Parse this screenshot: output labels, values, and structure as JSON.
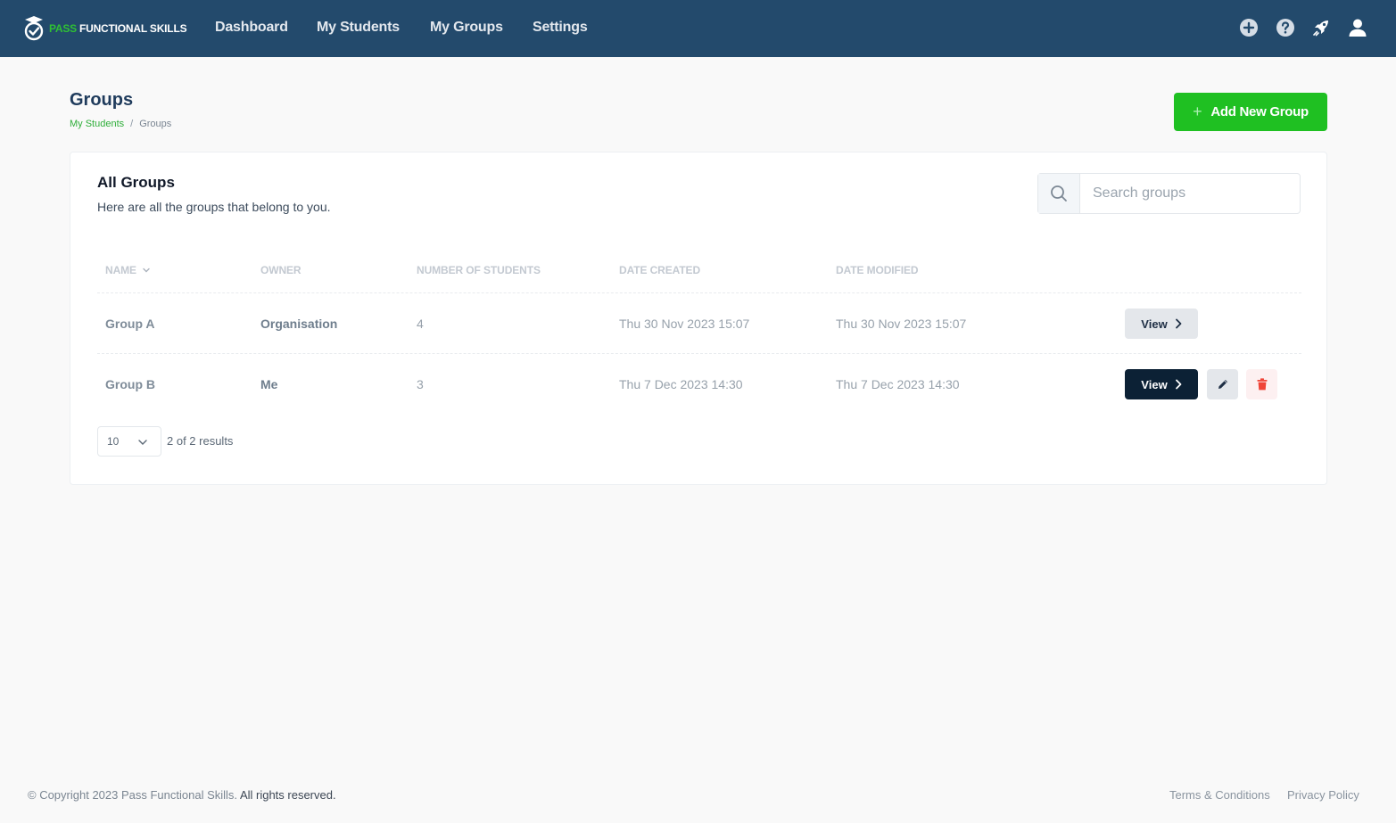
{
  "brand": {
    "part1": "PASS",
    "part2": "FUNCTIONAL SKILLS",
    "accent": "#2fc034"
  },
  "nav": {
    "items": [
      "Dashboard",
      "My Students",
      "My Groups",
      "Settings"
    ],
    "icons": [
      "plus-circle-icon",
      "help-circle-icon",
      "rocket-icon",
      "user-icon"
    ]
  },
  "header": {
    "title": "Groups",
    "breadcrumb": {
      "link": "My Students",
      "separator": "/",
      "current": "Groups"
    },
    "add_button": "Add New Group"
  },
  "card": {
    "title": "All Groups",
    "subtitle": "Here are all the groups that belong to you.",
    "search_placeholder": "Search groups",
    "columns": [
      "NAME",
      "OWNER",
      "NUMBER OF STUDENTS",
      "DATE CREATED",
      "DATE MODIFIED"
    ],
    "rows": [
      {
        "name": "Group A",
        "owner": "Organisation",
        "students": "4",
        "created": "Thu 30 Nov 2023 15:07",
        "modified": "Thu 30 Nov 2023 15:07",
        "view": "View"
      },
      {
        "name": "Group B",
        "owner": "Me",
        "students": "3",
        "created": "Thu 7 Dec 2023 14:30",
        "modified": "Thu 7 Dec 2023 14:30",
        "view": "View"
      }
    ],
    "page_size": "10",
    "results": "2 of 2 results"
  },
  "footer": {
    "copyright": "© Copyright 2023 Pass Functional Skills.",
    "rights": "All rights reserved.",
    "terms": "Terms & Conditions",
    "privacy": "Privacy Policy"
  }
}
